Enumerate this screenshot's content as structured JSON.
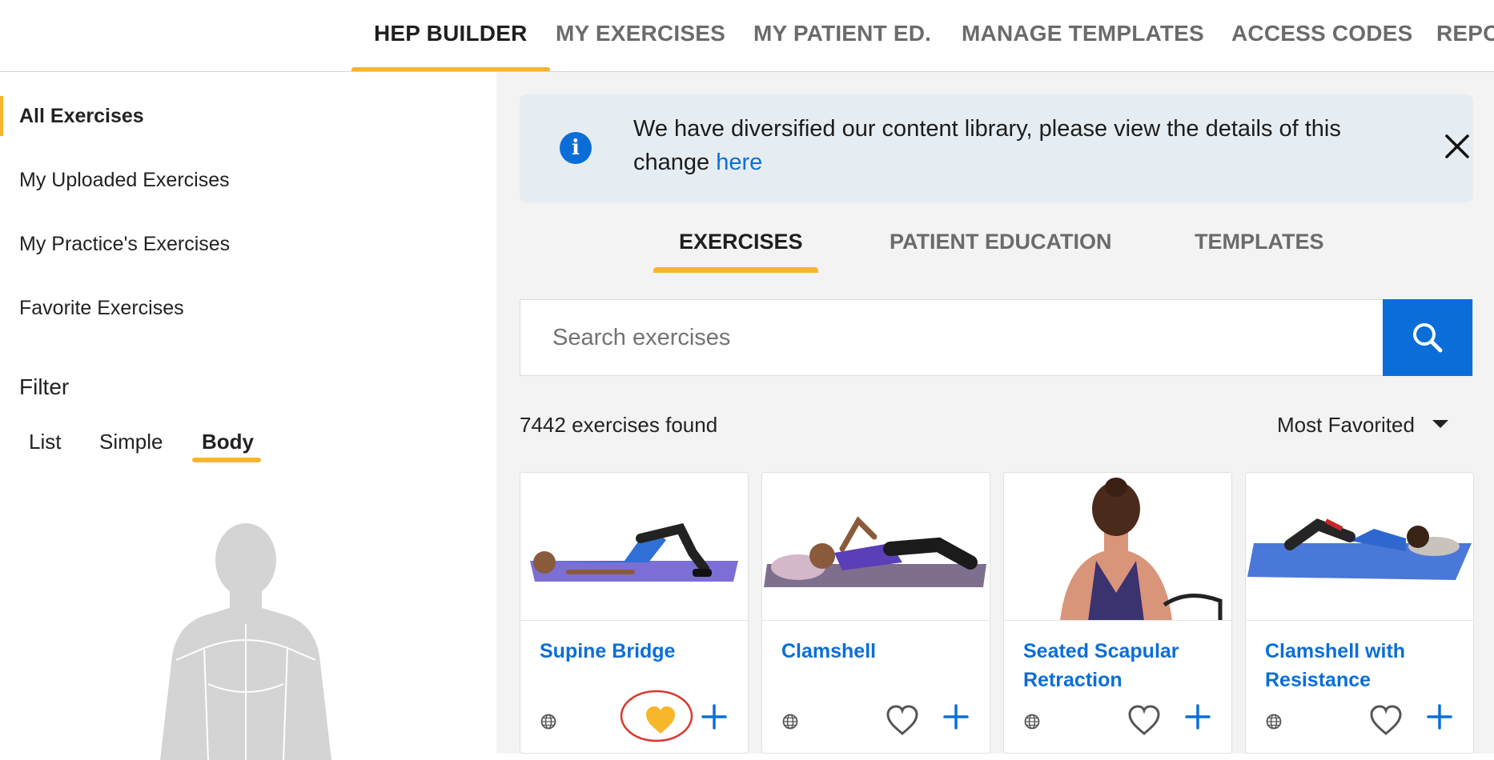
{
  "topnav": {
    "tabs": [
      {
        "label": "HEP BUILDER",
        "active": true
      },
      {
        "label": "MY EXERCISES",
        "active": false
      },
      {
        "label": "MY PATIENT ED.",
        "active": false
      },
      {
        "label": "MANAGE TEMPLATES",
        "active": false
      },
      {
        "label": "ACCESS CODES",
        "active": false
      },
      {
        "label": "REPO",
        "active": false
      }
    ]
  },
  "sidebar": {
    "items": [
      {
        "label": "All Exercises",
        "active": true
      },
      {
        "label": "My Uploaded Exercises",
        "active": false
      },
      {
        "label": "My Practice's Exercises",
        "active": false
      },
      {
        "label": "Favorite Exercises",
        "active": false
      }
    ],
    "filter": {
      "title": "Filter",
      "tabs": [
        {
          "label": "List",
          "active": false
        },
        {
          "label": "Simple",
          "active": false
        },
        {
          "label": "Body",
          "active": true
        }
      ]
    }
  },
  "banner": {
    "message": "We have diversified our content library, please view the details of this change",
    "link_text": "here",
    "icon": "info-icon"
  },
  "content_tabs": [
    {
      "label": "EXERCISES",
      "active": true
    },
    {
      "label": "PATIENT EDUCATION",
      "active": false
    },
    {
      "label": "TEMPLATES",
      "active": false
    }
  ],
  "search": {
    "placeholder": "Search exercises",
    "value": "",
    "icon": "search-icon"
  },
  "results": {
    "count_text": "7442 exercises found",
    "sort_label": "Most Favorited"
  },
  "cards": [
    {
      "title": "Supine Bridge",
      "favorited": true,
      "icon_globe": "globe-icon"
    },
    {
      "title": "Clamshell",
      "favorited": false,
      "icon_globe": "globe-icon"
    },
    {
      "title": "Seated Scapular Retraction",
      "favorited": false,
      "icon_globe": "globe-icon"
    },
    {
      "title": "Clamshell with Resistance",
      "favorited": false,
      "icon_globe": "globe-icon"
    }
  ],
  "colors": {
    "accent": "#f8b62d",
    "primary": "#0b6ed8",
    "favorite": "#f8b62d",
    "highlight_ring": "#d9382e"
  }
}
